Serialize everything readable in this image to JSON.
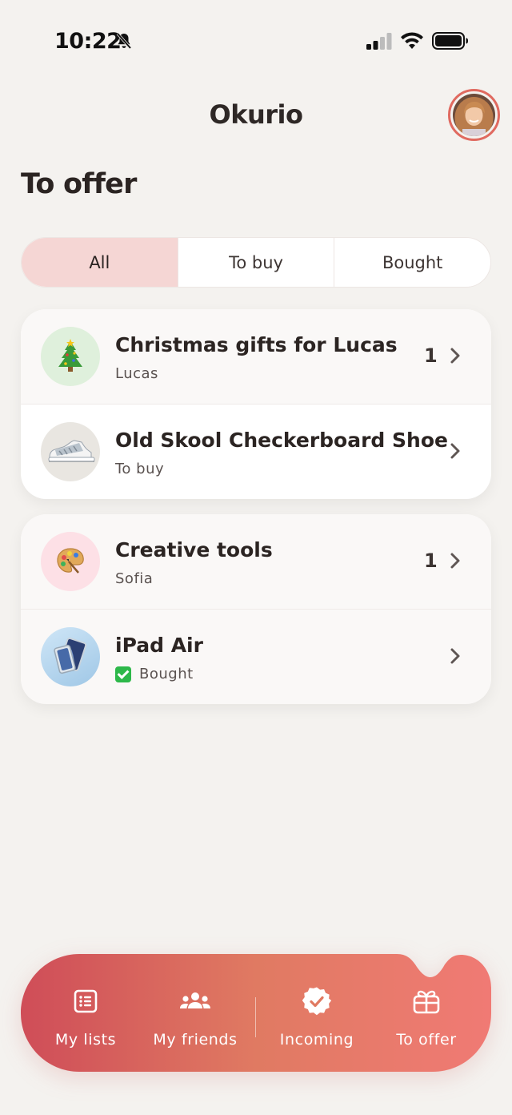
{
  "status_bar": {
    "time": "10:22"
  },
  "header": {
    "app_title": "Okurio"
  },
  "page": {
    "title": "To offer"
  },
  "filters": {
    "options": [
      "All",
      "To buy",
      "Bought"
    ],
    "selected": "All"
  },
  "groups": [
    {
      "items": [
        {
          "title": "Christmas gifts for Lucas",
          "subtitle": "Lucas",
          "count": "1",
          "icon": "christmas-tree-icon"
        },
        {
          "title": "Old Skool Checkerboard Shoe",
          "subtitle": "To buy",
          "icon": "sneaker-image"
        }
      ]
    },
    {
      "items": [
        {
          "title": "Creative tools",
          "subtitle": "Sofia",
          "count": "1",
          "icon": "palette-icon"
        },
        {
          "title": "iPad Air",
          "subtitle": "Bought",
          "icon": "ipad-image",
          "status_icon": "checkmark-icon"
        }
      ]
    }
  ],
  "tab_bar": {
    "tabs": [
      {
        "label": "My lists",
        "icon": "list-icon"
      },
      {
        "label": "My friends",
        "icon": "people-icon"
      },
      {
        "label": "Incoming",
        "icon": "verified-badge-icon"
      },
      {
        "label": "To offer",
        "icon": "gift-icon"
      }
    ],
    "active": "To offer"
  },
  "colors": {
    "background": "#f4f2ef",
    "accent_start": "#cf4d58",
    "accent_end": "#f07a74",
    "segment_active": "#f5d6d4"
  }
}
